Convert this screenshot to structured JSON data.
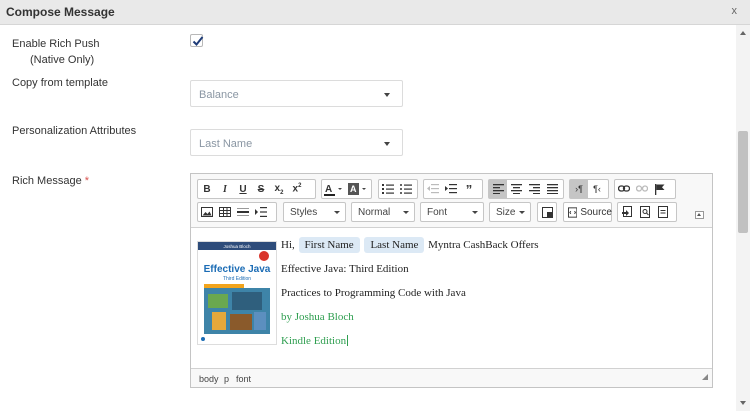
{
  "window": {
    "title": "Compose Message",
    "close_label": "x"
  },
  "form": {
    "rich_push_label": "Enable Rich Push",
    "rich_push_note": "(Native Only)",
    "rich_push_checked": true,
    "template_label": "Copy from template",
    "template_value": "Balance",
    "personalization_label": "Personalization Attributes",
    "personalization_value": "Last Name",
    "rich_message_label": "Rich Message",
    "required_mark": "*"
  },
  "toolbar": {
    "styles": "Styles",
    "format": "Normal",
    "font": "Font",
    "size": "Size",
    "source": "Source"
  },
  "editor": {
    "greeting": "Hi,",
    "chip_first": "First Name",
    "chip_last": "Last Name",
    "greeting_rest": "Myntra CashBack Offers",
    "line2": "Effective Java: Third Edition",
    "line3": "Practices to Programming Code with Java",
    "line4": "by Joshua Bloch",
    "line5": "Kindle Edition",
    "book": {
      "author": "Joshua Bloch",
      "title_line1": "Effective Java",
      "title_line2": "Third Edition"
    }
  },
  "path": [
    "body",
    "p",
    "font"
  ],
  "colors": {
    "accent_green": "#2e9e4f",
    "chip_bg": "#dce9f5",
    "required": "#d9534f"
  }
}
